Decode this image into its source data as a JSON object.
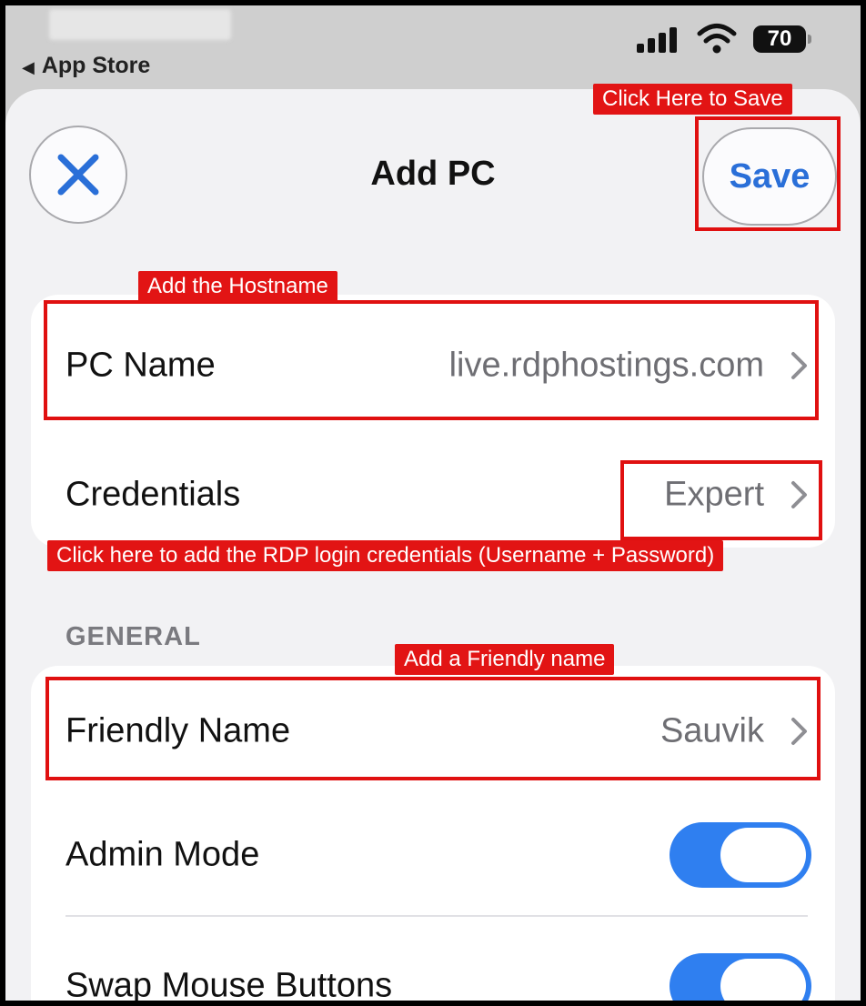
{
  "status_bar": {
    "back_label": "App Store",
    "battery": "70"
  },
  "header": {
    "title": "Add PC",
    "save_label": "Save"
  },
  "connection": {
    "pc_name_label": "PC Name",
    "pc_name_value": "live.rdphostings.com",
    "credentials_label": "Credentials",
    "credentials_value": "Expert"
  },
  "general": {
    "section_title": "GENERAL",
    "friendly_name_label": "Friendly Name",
    "friendly_name_value": "Sauvik",
    "admin_mode_label": "Admin Mode",
    "admin_mode_on": true,
    "swap_mouse_label": "Swap Mouse Buttons",
    "swap_mouse_on": true
  },
  "annotations": {
    "save_note": "Click Here to Save",
    "hostname_note": "Add the Hostname",
    "credentials_note": "Click here to add the RDP login credentials (Username + Password)",
    "friendly_note": "Add a Friendly name"
  },
  "colors": {
    "accent": "#2a6fd8",
    "toggle_on": "#2f7ff0",
    "annotation_red": "#e01010"
  }
}
